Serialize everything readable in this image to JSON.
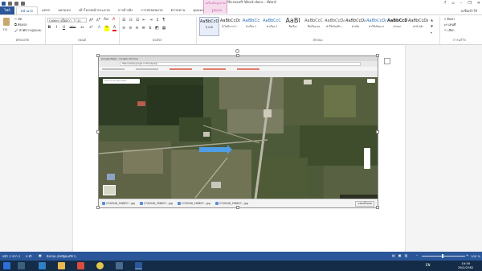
{
  "window": {
    "title": "New อกสาร Microsoft Word.docx - Word",
    "help": "?",
    "minimize": "–",
    "restore": "❐",
    "close": "✕",
    "signin": "ลงชื่อเข้าใช้"
  },
  "ribbon_tabs": {
    "context_label": "เครื่องมือรูปภาพ",
    "items": [
      "ไฟล์",
      "หน้าแรก",
      "แทรก",
      "ออกแบบ",
      "เค้าโครงหน้ากระดาษ",
      "การอ้างอิง",
      "การส่งจดหมาย",
      "ตรวจทาน",
      "มุมมอง",
      "รูปแบบ"
    ]
  },
  "clipboard": {
    "paste": "วาง",
    "cut": "ตัด",
    "copy": "คัดลอก",
    "format_painter": "ตัวคัดวางรูปแบบ",
    "group": "คลิปบอร์ด"
  },
  "font": {
    "name": "Calibri (เนื้อควา",
    "size": "11",
    "group": "ฟอนต์",
    "buttons": [
      "B",
      "I",
      "U",
      "abc",
      "x₂",
      "x²",
      "A",
      "A"
    ]
  },
  "paragraph": {
    "group": "ย่อหน้า"
  },
  "styles": {
    "group": "ลักษณะ",
    "items": [
      {
        "sample": "AaBbCcDc",
        "name": "¶ ปกติ"
      },
      {
        "sample": "AaBbCcDc",
        "name": "¶ ไม่มีการเว้..."
      },
      {
        "sample": "AaBbCc",
        "name": "หัวเรื่อง 1"
      },
      {
        "sample": "AaBbCcC",
        "name": "หัวเรื่อง 2"
      },
      {
        "sample": "AaBl",
        "name": "ชื่อเรื่อง"
      },
      {
        "sample": "AaBbCcC",
        "name": "ชื่อเรื่องรอง"
      },
      {
        "sample": "AaBbCcDa",
        "name": "ทำให้เน้นเล็ก..."
      },
      {
        "sample": "AaBbCcDa",
        "name": "ตัวเน้น"
      },
      {
        "sample": "AaBbCcDa",
        "name": "ทำให้เน้นมาก"
      },
      {
        "sample": "AaBbCcDa",
        "name": "ตัวหนา"
      },
      {
        "sample": "AaBbCcDx",
        "name": "คำอ้างอิง"
      }
    ]
  },
  "editing": {
    "find": "ค้นหา",
    "replace": "แทนที่",
    "select": "เลือก",
    "group": "การแก้ไข"
  },
  "browser": {
    "tab_title": "Google Maps - Google Chrome",
    "url": "https://www.google.co.th/maps/@...",
    "search_placeholder": "ค้นหาใน Google Maps"
  },
  "downloads": [
    "2740546_598837...jpg",
    "2740546_598837...jpg",
    "2740546_598837...jpg",
    "2740546_598837...jpg"
  ],
  "downloads_show_all": "แสดงทั้งหมด",
  "statusbar": {
    "page": "หน้า 2 จาก 2",
    "words": "0 คำ",
    "language": "อังกฤษ (สหรัฐอเมริกา)",
    "zoom": "100 %"
  },
  "taskbar": {
    "lang": "EN",
    "time": "19:59",
    "date": "26/2/2562"
  }
}
